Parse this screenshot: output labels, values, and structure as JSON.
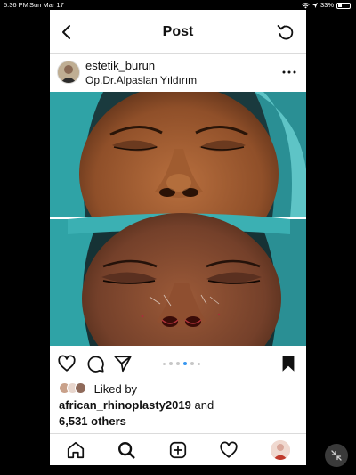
{
  "status_bar": {
    "time": "5:36 PM",
    "date": "Sun Mar 17",
    "battery": "33%",
    "battery_level": 0.33
  },
  "nav": {
    "title": "Post"
  },
  "post": {
    "username": "estetik_burun",
    "location": "Op.Dr.Alpaslan Yıldırım",
    "carousel": {
      "count": 6,
      "active_index": 3
    },
    "likes": {
      "prefix": "Liked by",
      "user": "african_rhinoplasty2019",
      "conjunction": "and",
      "others": "6,531 others"
    }
  },
  "icons": {
    "back": "chevron-left-icon",
    "refresh": "refresh-icon",
    "more": "more-horizontal-icon",
    "like": "heart-outline-icon",
    "comment": "comment-icon",
    "share": "send-icon",
    "save": "bookmark-filled-icon",
    "home": "home-icon",
    "search": "search-icon",
    "new_post": "plus-square-icon",
    "activity": "heart-outline-icon",
    "profile": "profile-avatar-icon"
  },
  "colors": {
    "accent": "#3897f0",
    "border": "#dbdbdb",
    "surgical_drape": "#2fa3a6"
  }
}
